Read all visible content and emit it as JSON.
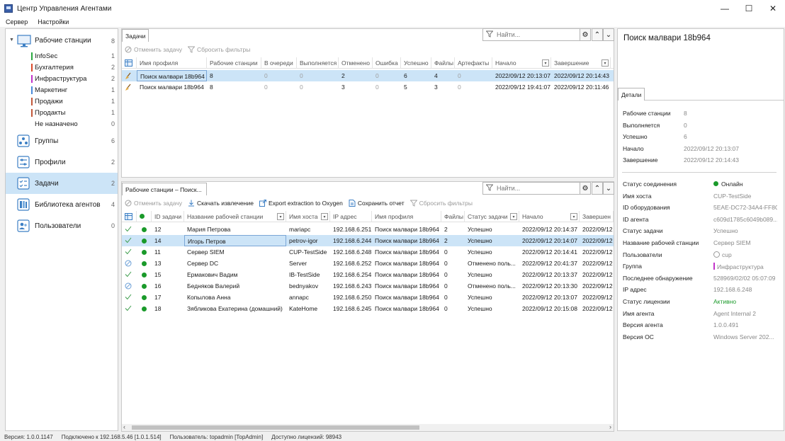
{
  "window": {
    "title": "Центр Управления Агентами",
    "minimize": "—",
    "maximize": "☐",
    "close": "✕"
  },
  "menu": {
    "items": [
      "Сервер",
      "Настройки"
    ]
  },
  "nav": {
    "root": {
      "label": "Рабочие станции",
      "count": "8"
    },
    "subitems": [
      {
        "label": "InfoSec",
        "count": "1",
        "color": "#2aa840"
      },
      {
        "label": "Бухгалтерия",
        "count": "2",
        "color": "#d94a2a"
      },
      {
        "label": "Инфраструктура",
        "count": "2",
        "color": "#c233c9"
      },
      {
        "label": "Маркетинг",
        "count": "1",
        "color": "#4a8ad9"
      },
      {
        "label": "Продажи",
        "count": "1",
        "color": "#c2583a"
      },
      {
        "label": "Продакты",
        "count": "1",
        "color": "#c2583a"
      },
      {
        "label": "Не назначено",
        "count": "0",
        "color": ""
      }
    ],
    "items": [
      {
        "label": "Группы",
        "count": "6",
        "icon": "groups-icon"
      },
      {
        "label": "Профили",
        "count": "2",
        "icon": "profiles-icon"
      },
      {
        "label": "Задачи",
        "count": "2",
        "icon": "tasks-icon"
      },
      {
        "label": "Библиотека агентов",
        "count": "4",
        "icon": "library-icon"
      },
      {
        "label": "Пользователи",
        "count": "0",
        "icon": "users-icon"
      }
    ]
  },
  "tasks_panel": {
    "tab": "Задачи",
    "search_placeholder": "Найти...",
    "toolbar": {
      "cancel": "Отменить задачу",
      "reset": "Сбросить фильтры"
    },
    "columns": [
      "Имя профиля",
      "Рабочие станции",
      "В очереди",
      "Выполняется",
      "Отменено",
      "Ошибка",
      "Успешно",
      "Файлы",
      "Артефакты",
      "Начало",
      "Завершение"
    ],
    "rows": [
      [
        "Поиск малвари 18b964",
        "8",
        "0",
        "0",
        "2",
        "0",
        "6",
        "4",
        "0",
        "2022/09/12 20:13:07",
        "2022/09/12 20:14:43"
      ],
      [
        "Поиск малвари 18b964",
        "8",
        "0",
        "0",
        "3",
        "0",
        "5",
        "3",
        "0",
        "2022/09/12 19:41:07",
        "2022/09/12 20:11:46"
      ]
    ]
  },
  "ws_panel": {
    "tab": "Рабочие станции – Поиск...",
    "search_placeholder": "Найти...",
    "toolbar": {
      "cancel": "Отменить задачу",
      "download": "Скачать извлечение",
      "export": "Export extraction to Oxygen",
      "save": "Сохранить отчет",
      "reset": "Сбросить фильтры"
    },
    "columns": [
      "ID задачи",
      "Название рабочей станции",
      "Имя хоста",
      "IP адрес",
      "Имя профиля",
      "Файлы",
      "Статус задачи",
      "Начало",
      "Завершен"
    ],
    "rows": [
      {
        "state": "check",
        "cells": [
          "12",
          "Мария Петрова",
          "mariapc",
          "192.168.6.251",
          "Поиск малвари 18b964",
          "2",
          "Успешно",
          "2022/09/12 20:14:37",
          "2022/09/12"
        ]
      },
      {
        "state": "check",
        "cells": [
          "14",
          "Игорь Петров",
          "petrov-igor",
          "192.168.6.244",
          "Поиск малвари 18b964",
          "2",
          "Успешно",
          "2022/09/12 20:14:07",
          "2022/09/12"
        ]
      },
      {
        "state": "check",
        "cells": [
          "11",
          "Сервер SIEM",
          "CUP-TestSide",
          "192.168.6.248",
          "Поиск малвари 18b964",
          "0",
          "Успешно",
          "2022/09/12 20:14:41",
          "2022/09/12"
        ]
      },
      {
        "state": "cancel",
        "cells": [
          "13",
          "Сервер DC",
          "Server",
          "192.168.6.252",
          "Поиск малвари 18b964",
          "0",
          "Отменено поль...",
          "2022/09/12 20:41:37",
          "2022/09/12"
        ]
      },
      {
        "state": "check",
        "cells": [
          "15",
          "Ермакович Вадим",
          "IB-TestSide",
          "192.168.6.254",
          "Поиск малвари 18b964",
          "0",
          "Успешно",
          "2022/09/12 20:13:37",
          "2022/09/12"
        ]
      },
      {
        "state": "cancel",
        "cells": [
          "16",
          "Бедняков Валерий",
          "bednyakov",
          "192.168.6.243",
          "Поиск малвари 18b964",
          "0",
          "Отменено поль...",
          "2022/09/12 20:13:30",
          "2022/09/12"
        ]
      },
      {
        "state": "check",
        "cells": [
          "17",
          "Копылова Анна",
          "annapc",
          "192.168.6.250",
          "Поиск малвари 18b964",
          "0",
          "Успешно",
          "2022/09/12 20:13:07",
          "2022/09/12"
        ]
      },
      {
        "state": "check",
        "cells": [
          "18",
          "Зябликова Екатерина (домашний)",
          "KateHome",
          "192.168.6.245",
          "Поиск малвари 18b964",
          "0",
          "Успешно",
          "2022/09/12 20:15:08",
          "2022/09/12"
        ]
      }
    ]
  },
  "details": {
    "title": "Поиск малвари 18b964",
    "tab": "Детали",
    "summary": [
      {
        "label": "Рабочие станции",
        "value": "8"
      },
      {
        "label": "Выполняется",
        "value": "0"
      },
      {
        "label": "Успешно",
        "value": "6"
      },
      {
        "label": "Начало",
        "value": "2022/09/12 20:13:07"
      },
      {
        "label": "Завершение",
        "value": "2022/09/12 20:14:43"
      }
    ],
    "station": [
      {
        "label": "Статус соединения",
        "value": "Онлайн"
      },
      {
        "label": "Имя хоста",
        "value": "CUP-TestSide"
      },
      {
        "label": "ID оборудования",
        "value": "5EAE-DC72-34A4-FF8C"
      },
      {
        "label": "ID агента",
        "value": "c609d1785c6049b089..."
      },
      {
        "label": "Статус задачи",
        "value": "Успешно"
      },
      {
        "label": "Название рабочей станции",
        "value": "Сервер SIEM"
      },
      {
        "label": "Пользователи",
        "value": "cup"
      },
      {
        "label": "Группа",
        "value": "Инфраструктура"
      },
      {
        "label": "Последнее обнаружение",
        "value": "528969/02/02 05:07:09"
      },
      {
        "label": "IP адрес",
        "value": "192.168.6.248"
      },
      {
        "label": "Статус лицензии",
        "value": "Активно"
      },
      {
        "label": "Имя агента",
        "value": "Agent Internal 2"
      },
      {
        "label": "Версия агента",
        "value": "1.0.0.491"
      },
      {
        "label": "Версия ОС",
        "value": "Windows Server 202..."
      }
    ]
  },
  "statusbar": {
    "version": "Версия: 1.0.0.1147",
    "connected": "Подключено к 192.168.5.46 [1.0.1.514]",
    "user": "Пользователь: topadmin [TopAdmin]",
    "licenses": "Доступно лицензий: 98943"
  },
  "colors": {
    "selection": "#cce4f7",
    "online": "#1a9a2a",
    "license_active": "#1a9a2a",
    "group_infra": "#c233c9"
  }
}
